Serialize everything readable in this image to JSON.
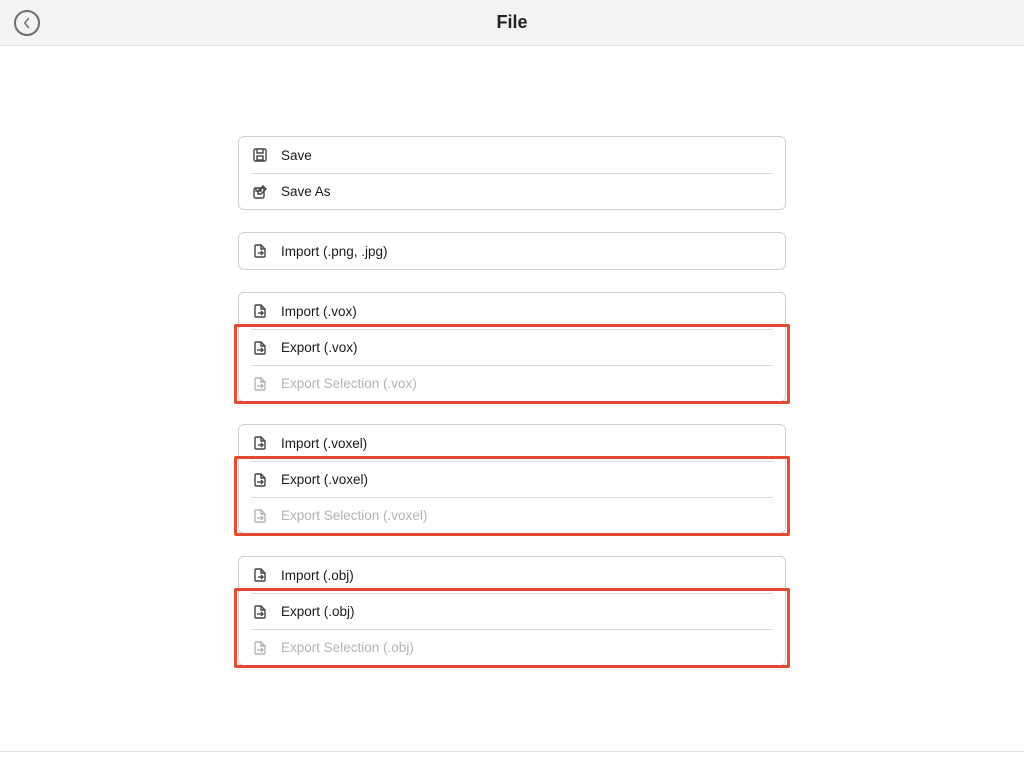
{
  "header": {
    "title": "File"
  },
  "groups": [
    {
      "name": "save-group",
      "rows": [
        {
          "id": "save",
          "icon": "save-icon",
          "label": "Save",
          "disabled": false
        },
        {
          "id": "save-as",
          "icon": "save-as-icon",
          "label": "Save As",
          "disabled": false
        }
      ],
      "highlight": null
    },
    {
      "name": "import-image-group",
      "rows": [
        {
          "id": "import-image",
          "icon": "import-icon",
          "label": "Import (.png, .jpg)",
          "disabled": false
        }
      ],
      "highlight": null
    },
    {
      "name": "vox-group",
      "rows": [
        {
          "id": "import-vox",
          "icon": "import-icon",
          "label": "Import (.vox)",
          "disabled": false
        },
        {
          "id": "export-vox",
          "icon": "export-icon",
          "label": "Export (.vox)",
          "disabled": false
        },
        {
          "id": "export-sel-vox",
          "icon": "export-icon",
          "label": "Export Selection (.vox)",
          "disabled": true
        }
      ],
      "highlight": {
        "startRow": 1,
        "endRow": 2
      }
    },
    {
      "name": "voxel-group",
      "rows": [
        {
          "id": "import-voxel",
          "icon": "import-icon",
          "label": "Import (.voxel)",
          "disabled": false
        },
        {
          "id": "export-voxel",
          "icon": "export-icon",
          "label": "Export (.voxel)",
          "disabled": false
        },
        {
          "id": "export-sel-voxel",
          "icon": "export-icon",
          "label": "Export Selection (.voxel)",
          "disabled": true
        }
      ],
      "highlight": {
        "startRow": 1,
        "endRow": 2
      }
    },
    {
      "name": "obj-group",
      "rows": [
        {
          "id": "import-obj",
          "icon": "import-icon",
          "label": "Import (.obj)",
          "disabled": false
        },
        {
          "id": "export-obj",
          "icon": "export-icon",
          "label": "Export (.obj)",
          "disabled": false
        },
        {
          "id": "export-sel-obj",
          "icon": "export-icon",
          "label": "Export Selection (.obj)",
          "disabled": true
        }
      ],
      "highlight": {
        "startRow": 1,
        "endRow": 2
      }
    }
  ]
}
